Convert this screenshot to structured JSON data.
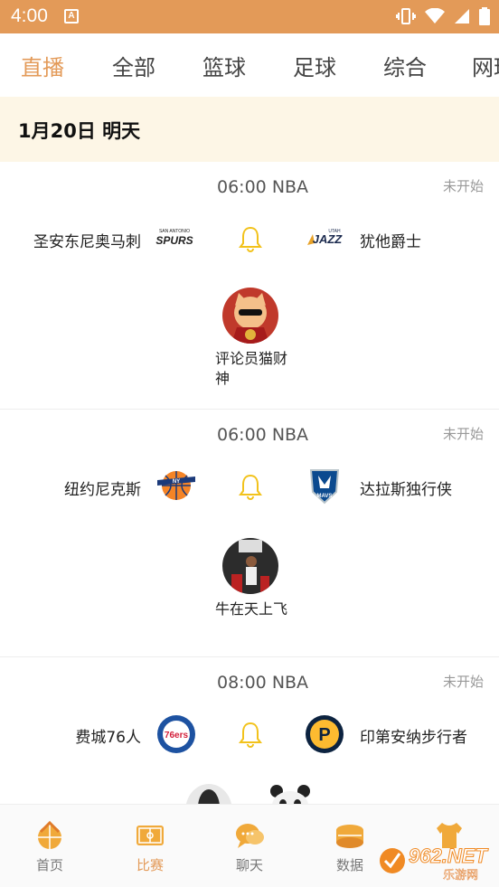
{
  "status": {
    "time": "4:00",
    "notice_glyph": "A"
  },
  "tabs": [
    {
      "label": "直播",
      "active": true
    },
    {
      "label": "全部"
    },
    {
      "label": "篮球"
    },
    {
      "label": "足球"
    },
    {
      "label": "综合"
    },
    {
      "label": "网球"
    }
  ],
  "date_header": "1月20日 明天",
  "matches": [
    {
      "time": "06:00",
      "league": "NBA",
      "status": "未开始",
      "home": "圣安东尼奥马刺",
      "away": "犹他爵士",
      "home_logo_text": "SPURS",
      "away_logo_text": "JAZZ",
      "commentator": "评论员猫财神"
    },
    {
      "time": "06:00",
      "league": "NBA",
      "status": "未开始",
      "home": "纽约尼克斯",
      "away": "达拉斯独行侠",
      "home_logo_text": "NY",
      "away_logo_text": "MAVS",
      "commentator": "牛在天上飞"
    },
    {
      "time": "08:00",
      "league": "NBA",
      "status": "未开始",
      "home": "费城76人",
      "away": "印第安纳步行者",
      "home_logo_text": "76ers",
      "away_logo_text": "P"
    }
  ],
  "bottom_nav": [
    {
      "label": "首页",
      "icon": "home-icon"
    },
    {
      "label": "比赛",
      "icon": "match-court-icon",
      "active": true
    },
    {
      "label": "聊天",
      "icon": "chat-icon"
    },
    {
      "label": "数据",
      "icon": "data-stadium-icon"
    },
    {
      "label": "",
      "icon": "jersey-icon"
    }
  ],
  "watermark": {
    "brand": "962.NET",
    "sub": "乐游网"
  },
  "colors": {
    "accent": "#e39a58",
    "date_band": "#fdf6e6",
    "bell": "#f2c21b"
  }
}
